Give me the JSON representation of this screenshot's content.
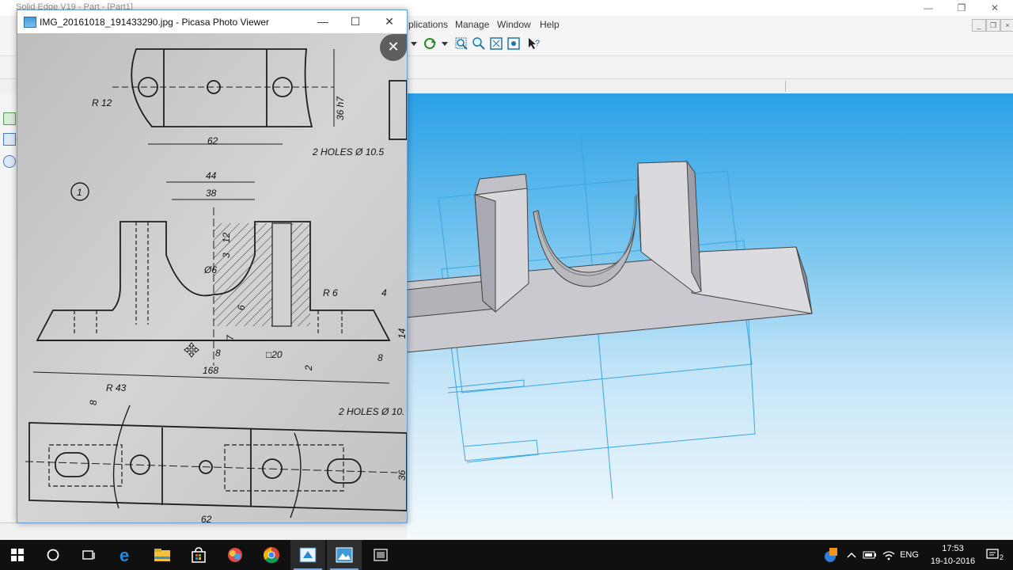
{
  "app": {
    "title": "Solid Edge V19 - Part - [Part1]",
    "menu": [
      {
        "label": "plications"
      },
      {
        "label": "Manage"
      },
      {
        "label": "Window"
      },
      {
        "label": "Help"
      }
    ],
    "window_controls": {
      "minimize": "—",
      "restore": "❐",
      "close": "✕"
    },
    "doc_controls": {
      "minimize": "_",
      "restore": "❐",
      "close": "×"
    }
  },
  "picasa": {
    "title": "IMG_20161018_191433290.jpg - Picasa Photo Viewer",
    "controls": {
      "minimize": "—",
      "maximize": "☐",
      "close": "✕"
    },
    "overlay_close": "✕",
    "drawing": {
      "labels": {
        "r12": "R 12",
        "h36": "36 h7",
        "d62": "62",
        "holes1": "2 HOLES Ø 10.5",
        "view1": "1",
        "d44": "44",
        "d38": "38",
        "d12": "12",
        "d3": "3",
        "phi6": "Ø6",
        "d6": "6",
        "d7": "7",
        "r6": "R 6",
        "d4": "4",
        "d14": "14",
        "d8a": "8",
        "sq20": "□20",
        "d2": "2",
        "d8b": "8",
        "d168": "168",
        "r43": "R 43",
        "d8c": "8",
        "holes2": "2 HOLES Ø 10.",
        "d36": "36",
        "d62b": "62"
      }
    }
  },
  "taskbar": {
    "tray_language": "ENG",
    "clock_time": "17:53",
    "clock_date": "19-10-2016",
    "notification_count": "2",
    "apps": [
      "start",
      "cortana",
      "task-view",
      "edge",
      "file-explorer",
      "store",
      "app-badge",
      "chrome",
      "solid-edge",
      "picasa",
      "app-generic"
    ],
    "active_apps": [
      "solid-edge",
      "picasa"
    ]
  },
  "colors": {
    "viewport_top": "#2aa0e6",
    "viewport_bottom": "#f4fafd",
    "sketch_lines": "#3aa6e0",
    "taskbar": "#101010"
  }
}
